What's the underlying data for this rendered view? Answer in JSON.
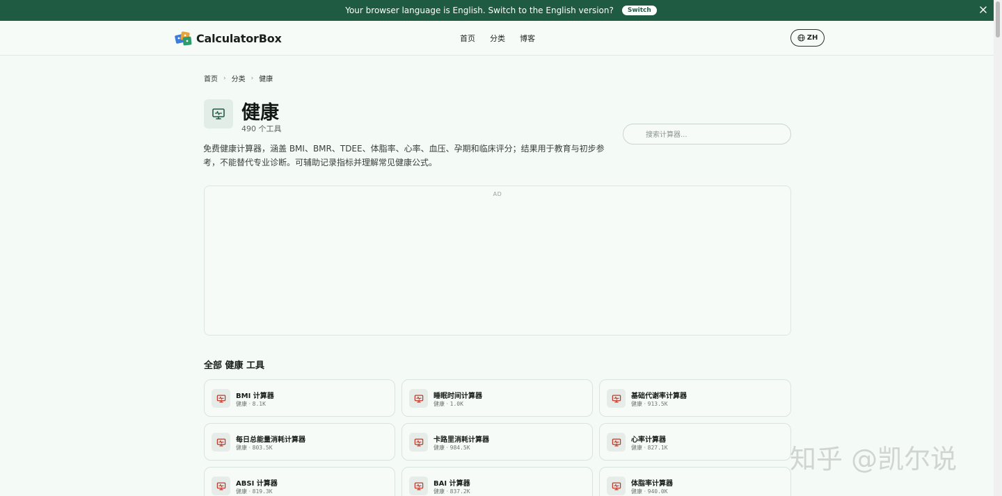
{
  "banner": {
    "message": "Your browser language is English. Switch to the English version?",
    "switch_label": "Switch"
  },
  "header": {
    "brand": "CalculatorBox",
    "nav": [
      "首页",
      "分类",
      "博客"
    ],
    "lang_label": "ZH"
  },
  "breadcrumb": [
    "首页",
    "分类",
    "健康"
  ],
  "category": {
    "title": "健康",
    "count": "490 个工具",
    "description": "免费健康计算器，涵盖 BMI、BMR、TDEE、体脂率、心率、血压、孕期和临床评分；结果用于教育与初步参考，不能替代专业诊断。可辅助记录指标并理解常见健康公式。"
  },
  "search": {
    "placeholder": "搜索计算器..."
  },
  "ad": {
    "label": "AD"
  },
  "section_title": "全部 健康 工具",
  "tools": [
    {
      "name": "BMI 计算器",
      "category": "健康 ·",
      "views": "8.1K"
    },
    {
      "name": "睡眠时间计算器",
      "category": "健康 ·",
      "views": "1.0K"
    },
    {
      "name": "基础代谢率计算器",
      "category": "健康 ·",
      "views": "913.5K"
    },
    {
      "name": "每日总能量消耗计算器",
      "category": "健康 ·",
      "views": "803.5K"
    },
    {
      "name": "卡路里消耗计算器",
      "category": "健康 ·",
      "views": "984.5K"
    },
    {
      "name": "心率计算器",
      "category": "健康 ·",
      "views": "827.1K"
    },
    {
      "name": "ABSI 计算器",
      "category": "健康 ·",
      "views": "819.3K"
    },
    {
      "name": "BAI 计算器",
      "category": "健康 ·",
      "views": "837.2K"
    },
    {
      "name": "体脂率计算器",
      "category": "健康 ·",
      "views": "940.0K"
    }
  ],
  "watermark": "知乎 @凯尔说",
  "colors": {
    "banner_bg": "#1f5a43",
    "page_bg": "#f4faf6",
    "icon_accent": "#c0392b",
    "category_icon": "#1f5a43"
  },
  "icons": {
    "category": "monitor-heart-icon",
    "tool": "monitor-heart-icon",
    "language": "globe-icon",
    "close": "close-icon",
    "breadcrumb_separator": "chevron-right-icon"
  }
}
